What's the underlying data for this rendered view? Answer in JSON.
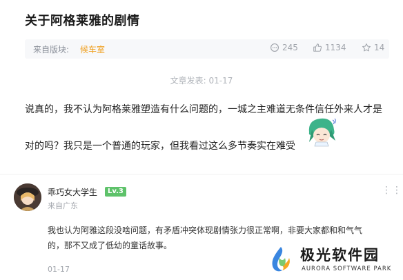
{
  "post": {
    "title": "关于阿格莱雅的剧情",
    "from_label": "来自版块:",
    "board": "候车室",
    "comments": "245",
    "likes": "1134",
    "favorites": "14",
    "publish_time": "文章发表: 01-17",
    "body_line1": "说真的，我不认为阿格莱雅塑造有什么问题的，一城之主难道无条件信任外来人才是",
    "body_line2": "对的吗？我只是一个普通的玩家，但我看过这么多节奏实在难受"
  },
  "icons": {
    "comments": "comment-bubble-icon",
    "likes": "thumbs-up-icon",
    "favorites": "star-icon",
    "more": "more-dots-icon"
  },
  "reply": {
    "username": "乖巧女大学生",
    "level": "Lv.3",
    "location": "来自广东",
    "more": "⋮⋮",
    "line1": "我也认为阿雅这段没啥问题，有矛盾冲突体现剧情张力很正常啊，非要大家都和和气气",
    "line2": "的，那不又成了低幼的童话故事。",
    "date": "01-17"
  },
  "watermark": {
    "name": "极光软件园",
    "sub": "AURORA SOFTWARE PARK"
  },
  "colors": {
    "accent_board": "#f0a020",
    "level_badge": "#5ec26a",
    "meta_bg": "#f7f8fa"
  }
}
